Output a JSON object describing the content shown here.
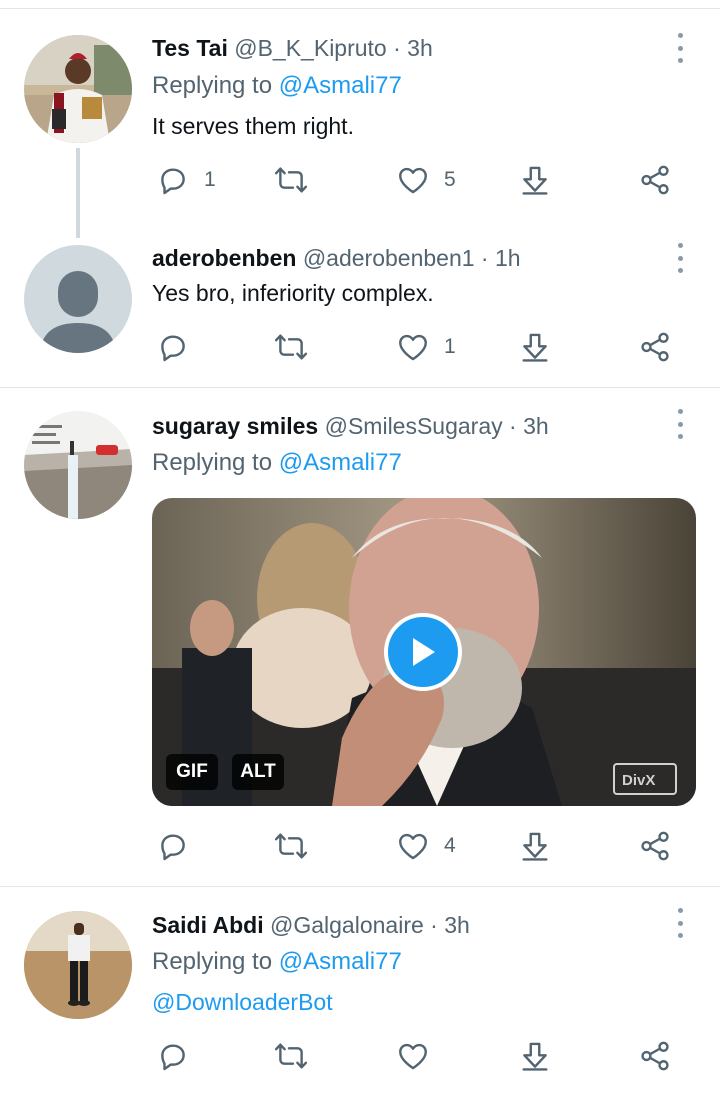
{
  "colors": {
    "accent": "#1d9bf0",
    "secondary_text": "#536471",
    "separator": "#e3e6e8"
  },
  "tweets": [
    {
      "name": "Tes Tai",
      "handle": "@B_K_Kipruto",
      "time": "· 3h",
      "replying_prefix": "Replying to ",
      "replying_to": "@Asmali77",
      "text": "It serves them right.",
      "reply_count": "1",
      "retweet_count": "",
      "like_count": "5"
    },
    {
      "name": "aderobenben",
      "handle": "@aderobenben1",
      "time": "· 1h",
      "text": "Yes bro, inferiority complex.",
      "reply_count": "",
      "retweet_count": "",
      "like_count": "1"
    },
    {
      "name": "sugaray smiles",
      "handle": "@SmilesSugaray",
      "time": "· 3h",
      "replying_prefix": "Replying to ",
      "replying_to": "@Asmali77",
      "media": {
        "gif_badge": "GIF",
        "alt_badge": "ALT",
        "watermark": "DivX"
      },
      "reply_count": "",
      "retweet_count": "",
      "like_count": "4"
    },
    {
      "name": "Saidi Abdi",
      "handle": "@Galgalonaire",
      "time": "· 3h",
      "replying_prefix": "Replying to ",
      "replying_to": "@Asmali77",
      "text": "@DownloaderBot",
      "reply_count": "",
      "retweet_count": "",
      "like_count": ""
    }
  ],
  "icons": [
    "reply-icon",
    "retweet-icon",
    "like-icon",
    "download-icon",
    "share-icon",
    "more-icon",
    "play-icon"
  ]
}
